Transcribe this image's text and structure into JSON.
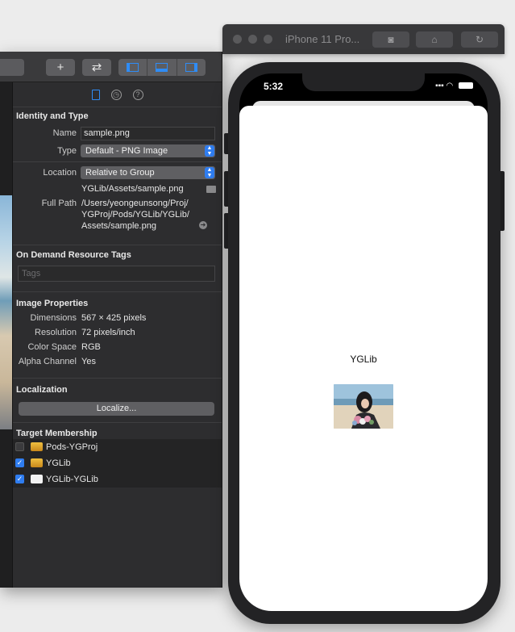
{
  "xcode": {
    "toolbar": {
      "add": "+",
      "swap": "⇄"
    },
    "inspector": {
      "identity": {
        "section_title": "Identity and Type",
        "name_label": "Name",
        "name_value": "sample.png",
        "type_label": "Type",
        "type_value": "Default - PNG Image",
        "location_label": "Location",
        "location_value": "Relative to Group",
        "location_path": "YGLib/Assets/sample.png",
        "full_path_label": "Full Path",
        "full_path_lines": [
          "/Users/yeongeunsong/Proj/",
          "YGProj/Pods/YGLib/YGLib/",
          "Assets/sample.png"
        ]
      },
      "on_demand": {
        "section_title": "On Demand Resource Tags",
        "tags_placeholder": "Tags"
      },
      "image_props": {
        "section_title": "Image Properties",
        "rows": [
          {
            "label": "Dimensions",
            "value": "567 × 425 pixels"
          },
          {
            "label": "Resolution",
            "value": "72 pixels/inch"
          },
          {
            "label": "Color Space",
            "value": "RGB"
          },
          {
            "label": "Alpha Channel",
            "value": "Yes"
          }
        ]
      },
      "localization": {
        "section_title": "Localization",
        "button_label": "Localize..."
      },
      "target_membership": {
        "section_title": "Target Membership",
        "targets": [
          {
            "label": "Pods-YGProj",
            "checked": false,
            "icon": "toolbox-icon"
          },
          {
            "label": "YGLib",
            "checked": true,
            "icon": "toolbox-icon"
          },
          {
            "label": "YGLib-YGLib",
            "checked": true,
            "icon": "bundle-icon"
          }
        ]
      }
    }
  },
  "simulator": {
    "title": "iPhone 11 Pro...",
    "status_time": "5:32",
    "app_label": "YGLib"
  },
  "colors": {
    "accent": "#2f7df0",
    "inspector_bg": "#2d2d2f"
  }
}
